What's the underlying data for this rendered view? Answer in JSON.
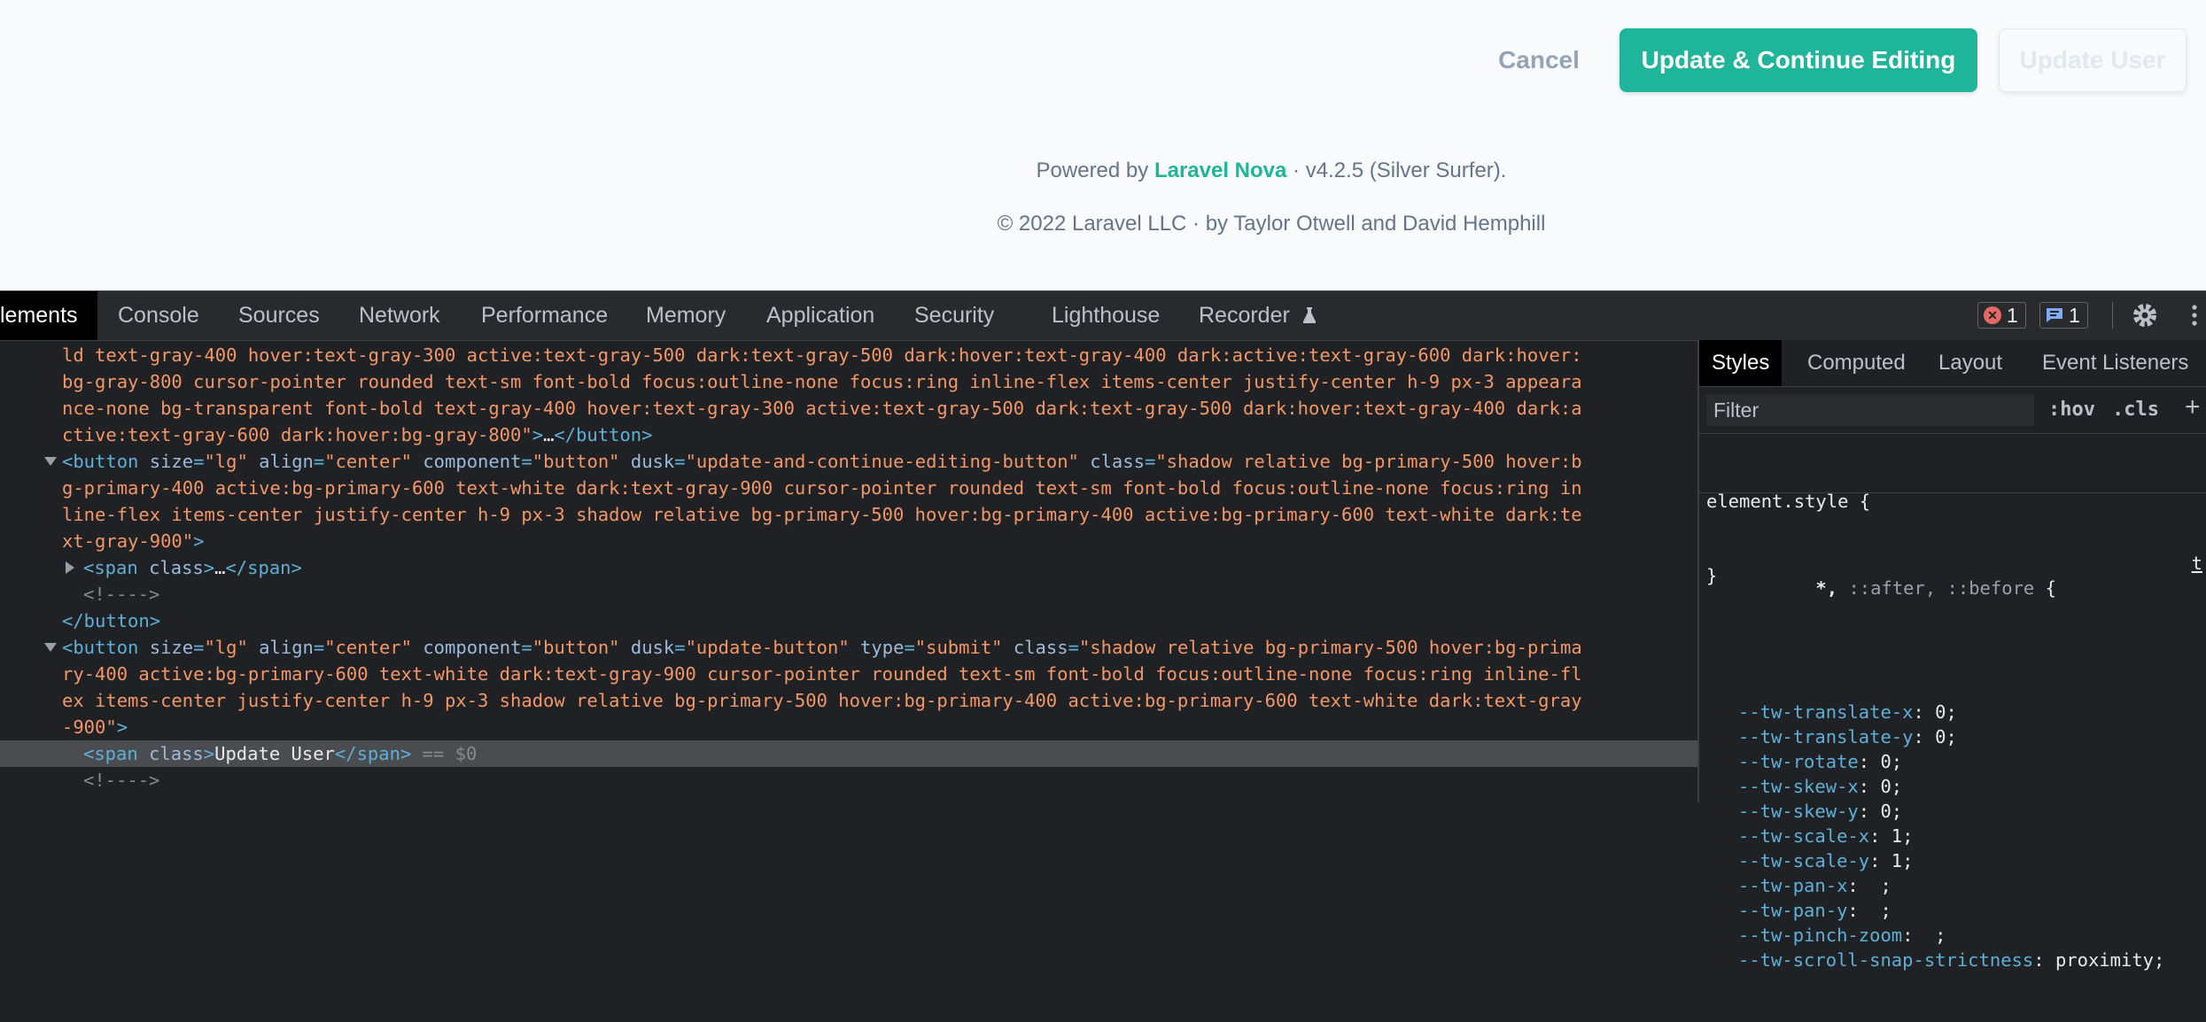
{
  "app": {
    "buttons": {
      "cancel": "Cancel",
      "update_continue": "Update & Continue Editing",
      "update_user": "Update User"
    },
    "footer": {
      "powered_prefix": "Powered by",
      "brand": "Laravel Nova",
      "version": "· v4.2.5 (Silver Surfer).",
      "copyright": "© 2022 Laravel LLC · by Taylor Otwell and David Hemphill"
    },
    "colors": {
      "primary": "#1fb59a",
      "muted": "#94a3b8",
      "page_bg": "#f8fafc"
    }
  },
  "devtools": {
    "tabs": [
      "lements",
      "Console",
      "Sources",
      "Network",
      "Performance",
      "Memory",
      "Application",
      "Security",
      "Lighthouse",
      "Recorder"
    ],
    "error_count": "1",
    "message_count": "1",
    "dom_lines": [
      {
        "segments": [
          [
            "val",
            "ld text-gray-400 hover:text-gray-300 active:text-gray-500 dark:text-gray-500 dark:hover:text-gray-400 dark:active:text-gray-600 dark:hover:"
          ]
        ]
      },
      {
        "segments": [
          [
            "val",
            "bg-gray-800 cursor-pointer rounded text-sm font-bold focus:outline-none focus:ring inline-flex items-center justify-center h-9 px-3 appeara"
          ]
        ]
      },
      {
        "segments": [
          [
            "val",
            "nce-none bg-transparent font-bold text-gray-400 hover:text-gray-300 active:text-gray-500 dark:text-gray-500 dark:hover:text-gray-400 dark:a"
          ]
        ]
      },
      {
        "segments": [
          [
            "val",
            "ctive:text-gray-600 dark:hover:bg-gray-800\""
          ],
          [
            "tag",
            ">"
          ],
          [
            "txt",
            "…"
          ],
          [
            "tag",
            "</button>"
          ]
        ]
      },
      {
        "tri": "down",
        "segments": [
          [
            "tag",
            "<button "
          ],
          [
            "attr",
            "size"
          ],
          [
            "tag",
            "="
          ],
          [
            "val",
            "\"lg\""
          ],
          [
            "attr",
            " align"
          ],
          [
            "tag",
            "="
          ],
          [
            "val",
            "\"center\""
          ],
          [
            "attr",
            " component"
          ],
          [
            "tag",
            "="
          ],
          [
            "val",
            "\"button\""
          ],
          [
            "attr",
            " dusk"
          ],
          [
            "tag",
            "="
          ],
          [
            "val",
            "\"update-and-continue-editing-button\""
          ],
          [
            "attr",
            " class"
          ],
          [
            "tag",
            "="
          ],
          [
            "val",
            "\"shadow relative bg-primary-500 hover:b"
          ]
        ]
      },
      {
        "segments": [
          [
            "val",
            "g-primary-400 active:bg-primary-600 text-white dark:text-gray-900 cursor-pointer rounded text-sm font-bold focus:outline-none focus:ring in"
          ]
        ]
      },
      {
        "segments": [
          [
            "val",
            "line-flex items-center justify-center h-9 px-3 shadow relative bg-primary-500 hover:bg-primary-400 active:bg-primary-600 text-white dark:te"
          ]
        ]
      },
      {
        "segments": [
          [
            "val",
            "xt-gray-900\""
          ],
          [
            "tag",
            ">"
          ]
        ]
      },
      {
        "tri": "right",
        "indent": 2,
        "segments": [
          [
            "tag",
            "<span "
          ],
          [
            "attr",
            "class"
          ],
          [
            "tag",
            ">"
          ],
          [
            "txt",
            "…"
          ],
          [
            "tag",
            "</span>"
          ]
        ]
      },
      {
        "indent": 2,
        "segments": [
          [
            "cmt",
            "<!---->"
          ]
        ]
      },
      {
        "segments": [
          [
            "tag",
            "</button>"
          ]
        ]
      },
      {
        "tri": "down",
        "segments": [
          [
            "tag",
            "<button "
          ],
          [
            "attr",
            "size"
          ],
          [
            "tag",
            "="
          ],
          [
            "val",
            "\"lg\""
          ],
          [
            "attr",
            " align"
          ],
          [
            "tag",
            "="
          ],
          [
            "val",
            "\"center\""
          ],
          [
            "attr",
            " component"
          ],
          [
            "tag",
            "="
          ],
          [
            "val",
            "\"button\""
          ],
          [
            "attr",
            " dusk"
          ],
          [
            "tag",
            "="
          ],
          [
            "val",
            "\"update-button\""
          ],
          [
            "attr",
            " type"
          ],
          [
            "tag",
            "="
          ],
          [
            "val",
            "\"submit\""
          ],
          [
            "attr",
            " class"
          ],
          [
            "tag",
            "="
          ],
          [
            "val",
            "\"shadow relative bg-primary-500 hover:bg-prima"
          ]
        ]
      },
      {
        "segments": [
          [
            "val",
            "ry-400 active:bg-primary-600 text-white dark:text-gray-900 cursor-pointer rounded text-sm font-bold focus:outline-none focus:ring inline-fl"
          ]
        ]
      },
      {
        "segments": [
          [
            "val",
            "ex items-center justify-center h-9 px-3 shadow relative bg-primary-500 hover:bg-primary-400 active:bg-primary-600 text-white dark:text-gray"
          ]
        ]
      },
      {
        "segments": [
          [
            "val",
            "-900\""
          ],
          [
            "tag",
            ">"
          ]
        ]
      },
      {
        "selected": true,
        "indent": 2,
        "segments": [
          [
            "tag",
            "<span "
          ],
          [
            "attr",
            "class"
          ],
          [
            "tag",
            ">"
          ],
          [
            "txt",
            "Update User"
          ],
          [
            "tag",
            "</span>"
          ],
          [
            "dim",
            " == "
          ],
          [
            "dim",
            "$0"
          ]
        ]
      },
      {
        "indent": 2,
        "segments": [
          [
            "cmt",
            "<!---->"
          ]
        ]
      }
    ],
    "styles_panel": {
      "tabs": [
        "Styles",
        "Computed",
        "Layout",
        "Event Listeners"
      ],
      "filter_placeholder": "Filter",
      "hov": ":hov",
      "cls": ".cls",
      "plus": "+",
      "element_style": "element.style",
      "open_brace": " {",
      "close_brace": "}",
      "universal_selector": "*,",
      "universal_pseudo": " ::after, ::before",
      "link_char": "t",
      "properties": [
        [
          "--tw-translate-x",
          "0;"
        ],
        [
          "--tw-translate-y",
          "0;"
        ],
        [
          "--tw-rotate",
          "0;"
        ],
        [
          "--tw-skew-x",
          "0;"
        ],
        [
          "--tw-skew-y",
          "0;"
        ],
        [
          "--tw-scale-x",
          "1;"
        ],
        [
          "--tw-scale-y",
          "1;"
        ],
        [
          "--tw-pan-x",
          " ;"
        ],
        [
          "--tw-pan-y",
          " ;"
        ],
        [
          "--tw-pinch-zoom",
          " ;"
        ],
        [
          "--tw-scroll-snap-strictness",
          "proximity;"
        ]
      ]
    }
  }
}
